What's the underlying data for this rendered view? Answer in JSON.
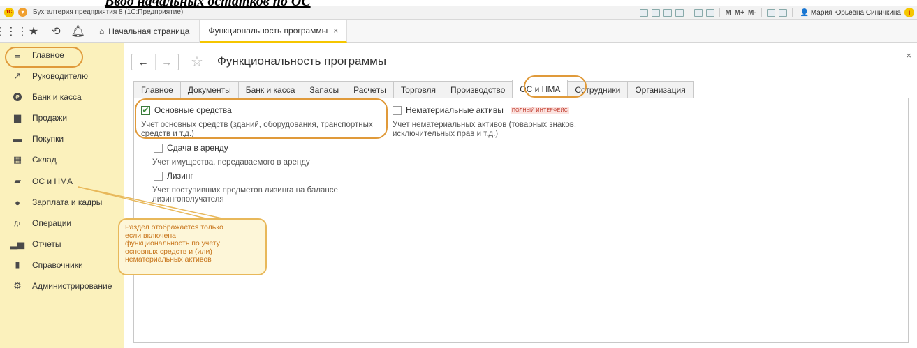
{
  "heading_overlay": "Ввод начальных остатков по ОС",
  "titlebar": {
    "logo": "1С",
    "app_title": "Бухгалтерия предприятия 8  (1С:Предприятие)",
    "user_name": "Мария Юрьевна Синичкина",
    "m_labels": [
      "M",
      "M+",
      "M-"
    ]
  },
  "tabbar": {
    "home_label": "Начальная страница",
    "active_tab_label": "Функциональность программы",
    "close_glyph": "×"
  },
  "sidebar": {
    "items": [
      {
        "label": "Главное",
        "icon": "menu-lines-icon"
      },
      {
        "label": "Руководителю",
        "icon": "trend-arrow-icon"
      },
      {
        "label": "Банк и касса",
        "icon": "ruble-coin-icon"
      },
      {
        "label": "Продажи",
        "icon": "shopping-bag-icon"
      },
      {
        "label": "Покупки",
        "icon": "cart-icon"
      },
      {
        "label": "Склад",
        "icon": "warehouse-icon"
      },
      {
        "label": "ОС и НМА",
        "icon": "truck-icon"
      },
      {
        "label": "Зарплата и кадры",
        "icon": "person-icon"
      },
      {
        "label": "Операции",
        "icon": "dt-kt-icon"
      },
      {
        "label": "Отчеты",
        "icon": "bar-chart-icon"
      },
      {
        "label": "Справочники",
        "icon": "book-icon"
      },
      {
        "label": "Администрирование",
        "icon": "gear-icon"
      }
    ]
  },
  "content": {
    "title": "Функциональность программы",
    "tabs": [
      "Главное",
      "Документы",
      "Банк и касса",
      "Запасы",
      "Расчеты",
      "Торговля",
      "Производство",
      "ОС и НМА",
      "Сотрудники",
      "Организация"
    ],
    "active_tab": "ОС и НМА",
    "options": {
      "fixed_assets": {
        "label": "Основные средства",
        "checked": true,
        "desc1": "Учет основных средств (зданий, оборудования, транспортных",
        "desc2": "средств и т.д.)"
      },
      "intangibles": {
        "label": "Нематериальные активы",
        "checked": false,
        "badge": "полный интерфейс",
        "desc1": "Учет нематериальных активов (товарных знаков,",
        "desc2": "исключительных прав и т.д.)"
      },
      "lease": {
        "label": "Сдача в аренду",
        "checked": false,
        "desc1": "Учет имущества, передаваемого в аренду"
      },
      "leasing": {
        "label": "Лизинг",
        "checked": false,
        "desc1": "Учет поступивших предметов лизинга на балансе",
        "desc2": "лизингополучателя"
      }
    }
  },
  "callout": {
    "lines": [
      "Раздел отображается только",
      "если включена",
      "функциональность по учету",
      "основных средств и (или)",
      "нематериальных активов"
    ]
  },
  "colors": {
    "accent": "#f5c600",
    "sidebar_bg": "#fbf1bc",
    "highlight": "#e09a3a",
    "callout_text": "#c7741a"
  }
}
